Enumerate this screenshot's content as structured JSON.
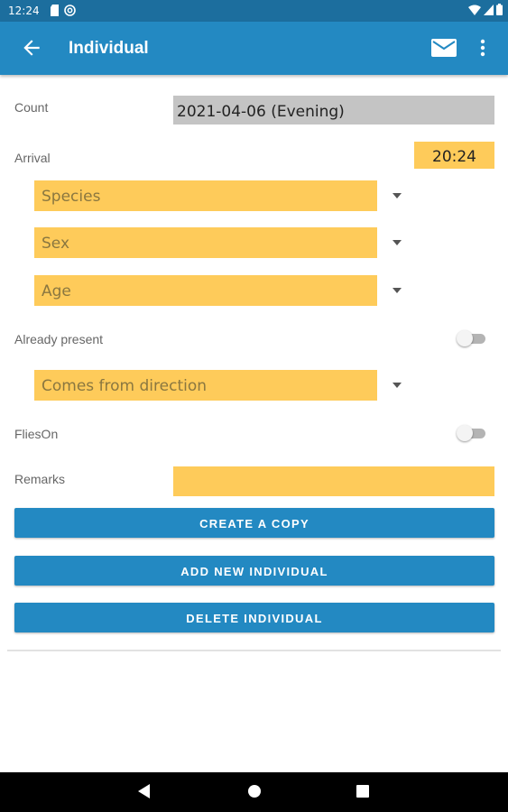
{
  "status_bar": {
    "time": "12:24",
    "icons": [
      "sd-card-icon",
      "at-sign-icon",
      "wifi-icon",
      "cell-signal-icon",
      "battery-icon"
    ]
  },
  "app_bar": {
    "title": "Individual",
    "icons": [
      "back-arrow-icon",
      "mail-icon",
      "more-vert-icon"
    ],
    "color": "#2389c2"
  },
  "form": {
    "count_label": "Count",
    "count_value": "2021-04-06 (Evening)",
    "arrival_label": "Arrival",
    "arrival_value": "20:24",
    "species_placeholder": "Species",
    "sex_placeholder": "Sex",
    "age_placeholder": "Age",
    "already_present_label": "Already present",
    "already_present_on": false,
    "direction_placeholder": "Comes from direction",
    "flies_on_label": "FliesOn",
    "flies_on_on": false,
    "remarks_label": "Remarks",
    "remarks_value": ""
  },
  "buttons": {
    "create_copy": "CREATE A COPY",
    "add_new": "ADD NEW INDIVIDUAL",
    "delete": "DELETE INDIVIDUAL"
  },
  "colors": {
    "accent": "#2389c2",
    "field_yellow": "#fecb5a",
    "field_grey": "#c4c4c4"
  },
  "nav_bar": {
    "icons": [
      "back-triangle-icon",
      "home-circle-icon",
      "recents-square-icon"
    ]
  }
}
